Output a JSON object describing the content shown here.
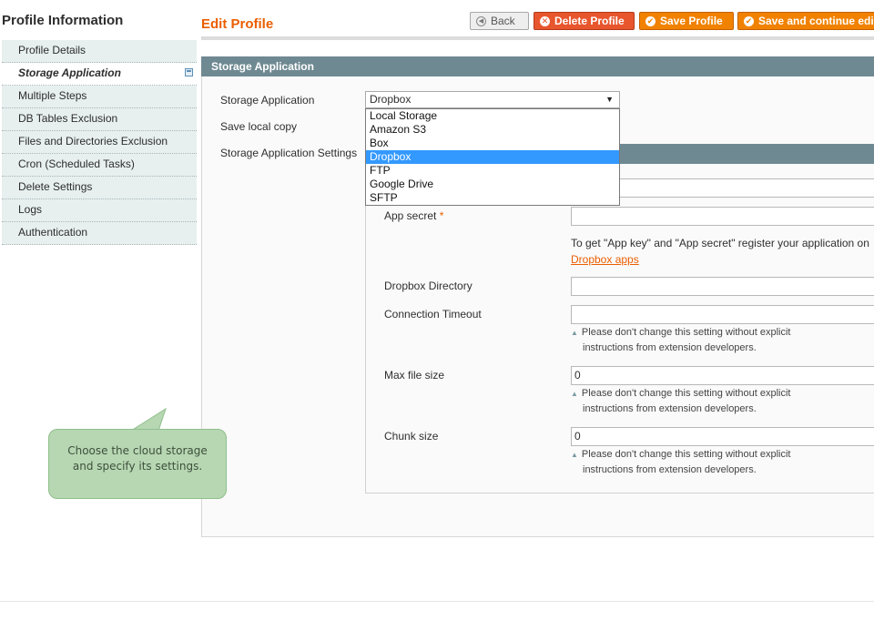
{
  "sidebar": {
    "title": "Profile Information",
    "items": [
      {
        "label": "Profile Details"
      },
      {
        "label": "Storage Application"
      },
      {
        "label": "Multiple Steps"
      },
      {
        "label": "DB Tables Exclusion"
      },
      {
        "label": "Files and Directories Exclusion"
      },
      {
        "label": "Cron (Scheduled Tasks)"
      },
      {
        "label": "Delete Settings"
      },
      {
        "label": "Logs"
      },
      {
        "label": "Authentication"
      }
    ]
  },
  "header": {
    "title": "Edit Profile",
    "buttons": {
      "back": "Back",
      "delete": "Delete Profile",
      "save": "Save Profile",
      "save_continue": "Save and continue edit"
    }
  },
  "section": {
    "title": "Storage Application",
    "storage_label": "Storage Application",
    "storage_value": "Dropbox",
    "save_local_label": "Save local copy",
    "settings_label": "Storage Application Settings"
  },
  "dropdown": {
    "options": [
      "Local Storage",
      "Amazon S3",
      "Box",
      "Dropbox",
      "FTP",
      "Google Drive",
      "SFTP"
    ],
    "selected": "Dropbox"
  },
  "settings": {
    "app_secret_label": "App secret",
    "required_mark": "*",
    "register_text": "To get \"App key\" and \"App secret\" register your application on",
    "dropbox_apps_link": "Dropbox apps",
    "directory_label": "Dropbox Directory",
    "timeout_label": "Connection Timeout",
    "max_file_label": "Max file size",
    "max_file_value": "0",
    "chunk_label": "Chunk size",
    "chunk_value": "0",
    "note_line1": "Please don't change this setting without explicit",
    "note_line2": "instructions from extension developers."
  },
  "callout": {
    "line1": "Choose the cloud storage",
    "line2": "and specify its settings."
  },
  "colors": {
    "accent": "#eb5e00",
    "section_header": "#6f8992",
    "sidebar_bg": "#e7efef",
    "delete_button": "#e8562d",
    "save_button": "#f18200",
    "callout_bg": "#b7d7b3",
    "selected_option": "#3399ff"
  }
}
